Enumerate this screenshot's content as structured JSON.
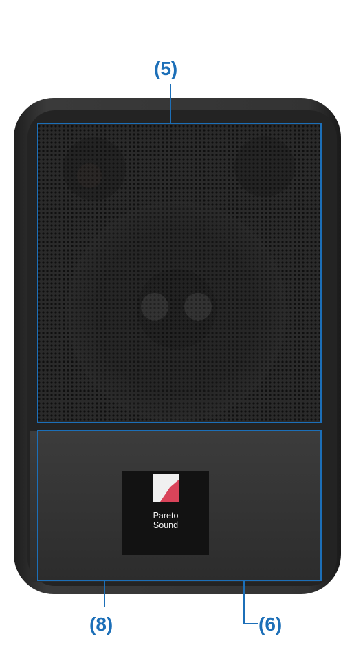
{
  "callouts": {
    "top": "(5)",
    "bottom_left": "(8)",
    "bottom_right": "(6)"
  },
  "logo": {
    "line1": "Pareto",
    "line2": "Sound"
  },
  "colors": {
    "callout": "#1c6fb8",
    "cabinet": "#2b2b2b",
    "grille": "#1a1a1a",
    "logo_red": "#d9445a"
  },
  "icons": {
    "logo_mark": "pareto-sound-logo-icon"
  }
}
